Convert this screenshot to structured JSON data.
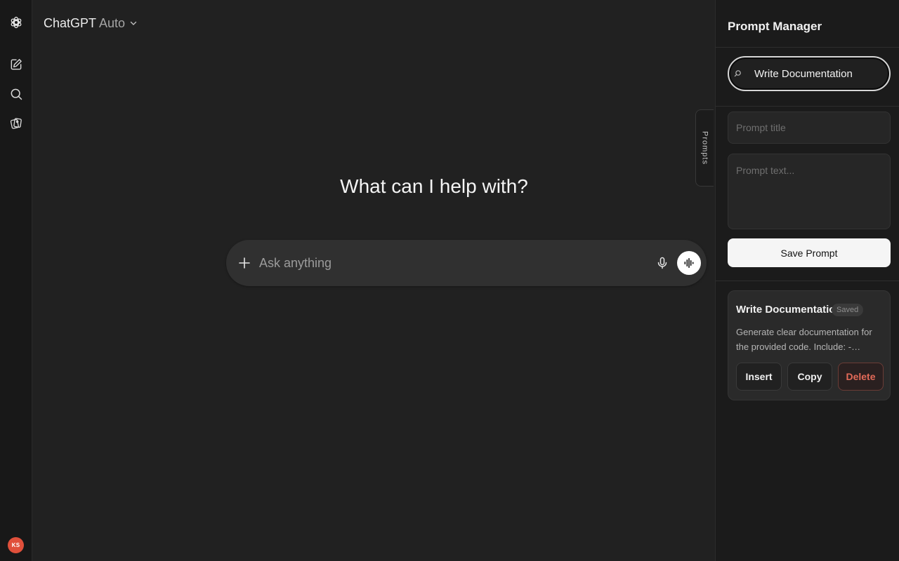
{
  "header": {
    "brand": "ChatGPT",
    "model": "Auto"
  },
  "sidebar": {
    "items": [
      {
        "name": "new-chat",
        "icon": "edit-icon"
      },
      {
        "name": "search-chats",
        "icon": "search-icon"
      },
      {
        "name": "library",
        "icon": "images-icon"
      }
    ],
    "avatar_initials": "KS",
    "avatar_color": "#e0503b"
  },
  "main": {
    "heading": "What can I help with?",
    "composer": {
      "placeholder": "Ask anything"
    }
  },
  "prompts_tab": {
    "label": "Prompts"
  },
  "panel": {
    "title": "Prompt Manager",
    "search_value": "Write Documentation",
    "title_placeholder": "Prompt title",
    "text_placeholder": "Prompt text...",
    "save_label": "Save Prompt",
    "saved_prompts": [
      {
        "title": "Write Documentation",
        "badge": "Saved",
        "description": "Generate clear documentation for the provided code. Include: - Purpose of...",
        "insert_label": "Insert",
        "copy_label": "Copy",
        "delete_label": "Delete"
      }
    ]
  }
}
